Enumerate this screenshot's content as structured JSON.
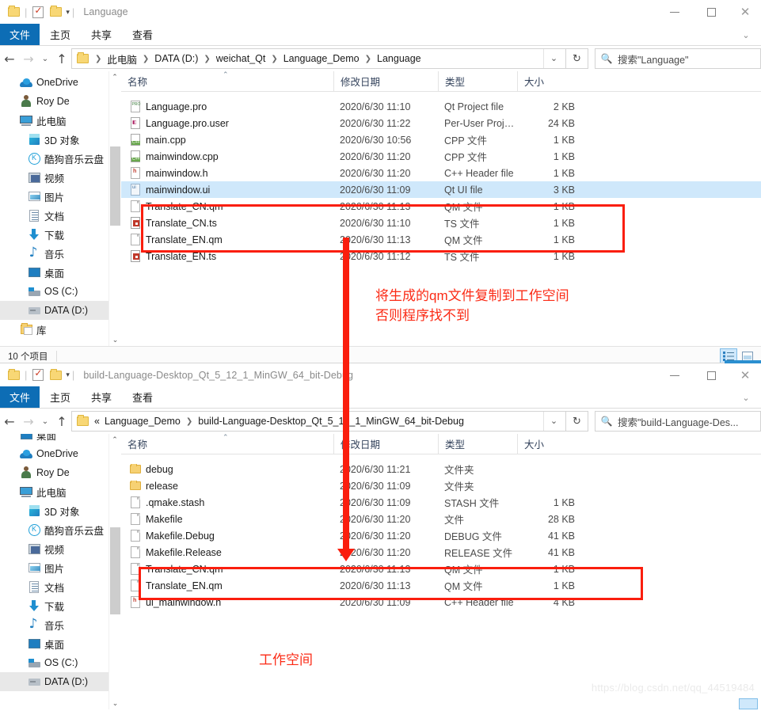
{
  "windows": [
    {
      "id": "window-language",
      "title": "Language",
      "quick_access": {
        "folder_icon": "folder-icon",
        "checkbox_icon": "checkbox-icon",
        "folder_icon_2": "folder-icon",
        "caret_icon": "chevron-down-icon"
      },
      "window_controls": {
        "minimize": "minimize-icon",
        "maximize": "maximize-icon",
        "close": "close-icon"
      },
      "ribbon_tabs": [
        {
          "label": "文件",
          "active": true
        },
        {
          "label": "主页",
          "active": false
        },
        {
          "label": "共享",
          "active": false
        },
        {
          "label": "查看",
          "active": false
        }
      ],
      "nav": {
        "back": "arrow-left-icon",
        "forward": "arrow-right-icon",
        "recent": "chevron-down-icon",
        "up": "arrow-up-icon"
      },
      "breadcrumbs": [
        "此电脑",
        "DATA (D:)",
        "weichat_Qt",
        "Language_Demo",
        "Language"
      ],
      "address_caret": "chevron-down-icon",
      "refresh": "refresh-icon",
      "search": {
        "placeholder": "搜索\"Language\"",
        "icon": "search-icon"
      },
      "nav_pane": [
        {
          "label": "OneDrive",
          "icon": "onedrive-cloud-icon",
          "indent": 1,
          "selected": false
        },
        {
          "label": "Roy De",
          "icon": "user-icon",
          "indent": 1,
          "selected": false
        },
        {
          "label": "此电脑",
          "icon": "this-pc-icon",
          "indent": 1,
          "selected": false
        },
        {
          "label": "3D 对象",
          "icon": "3d-objects-icon",
          "indent": 2,
          "selected": false
        },
        {
          "label": "酷狗音乐云盘",
          "icon": "kugou-cloud-icon",
          "indent": 2,
          "selected": false
        },
        {
          "label": "视频",
          "icon": "videos-icon",
          "indent": 2,
          "selected": false
        },
        {
          "label": "图片",
          "icon": "pictures-icon",
          "indent": 2,
          "selected": false
        },
        {
          "label": "文档",
          "icon": "documents-icon",
          "indent": 2,
          "selected": false
        },
        {
          "label": "下载",
          "icon": "downloads-icon",
          "indent": 2,
          "selected": false
        },
        {
          "label": "音乐",
          "icon": "music-icon",
          "indent": 2,
          "selected": false
        },
        {
          "label": "桌面",
          "icon": "desktop-icon",
          "indent": 2,
          "selected": false
        },
        {
          "label": "OS (C:)",
          "icon": "os-drive-icon",
          "indent": 2,
          "selected": false
        },
        {
          "label": "DATA (D:)",
          "icon": "drive-icon",
          "indent": 2,
          "selected": true
        },
        {
          "label": "库",
          "icon": "libraries-icon",
          "indent": 1,
          "selected": false
        }
      ],
      "nav_scroll": {
        "up": "scroll-up-icon",
        "down": "scroll-down-icon"
      },
      "columns": [
        "名称",
        "修改日期",
        "类型",
        "大小"
      ],
      "sort_column": "名称",
      "sort_direction": "ascending",
      "files": [
        {
          "name": "Language.pro",
          "date": "2020/6/30 11:10",
          "type": "Qt Project file",
          "size": "2 KB",
          "icon": "pro-file-icon",
          "selected": false
        },
        {
          "name": "Language.pro.user",
          "date": "2020/6/30 11:22",
          "type": "Per-User Project...",
          "size": "24 KB",
          "icon": "user-file-icon",
          "selected": false
        },
        {
          "name": "main.cpp",
          "date": "2020/6/30 10:56",
          "type": "CPP 文件",
          "size": "1 KB",
          "icon": "cpp-file-icon",
          "selected": false
        },
        {
          "name": "mainwindow.cpp",
          "date": "2020/6/30 11:20",
          "type": "CPP 文件",
          "size": "1 KB",
          "icon": "cpp-file-icon",
          "selected": false
        },
        {
          "name": "mainwindow.h",
          "date": "2020/6/30 11:20",
          "type": "C++ Header file",
          "size": "1 KB",
          "icon": "h-file-icon",
          "selected": false
        },
        {
          "name": "mainwindow.ui",
          "date": "2020/6/30 11:09",
          "type": "Qt UI file",
          "size": "3 KB",
          "icon": "ui-file-icon",
          "selected": true
        },
        {
          "name": "Translate_CN.qm",
          "date": "2020/6/30 11:13",
          "type": "QM 文件",
          "size": "1 KB",
          "icon": "qm-file-icon",
          "selected": false
        },
        {
          "name": "Translate_CN.ts",
          "date": "2020/6/30 11:10",
          "type": "TS 文件",
          "size": "1 KB",
          "icon": "ts-file-icon",
          "selected": false
        },
        {
          "name": "Translate_EN.qm",
          "date": "2020/6/30 11:13",
          "type": "QM 文件",
          "size": "1 KB",
          "icon": "qm-file-icon",
          "selected": false
        },
        {
          "name": "Translate_EN.ts",
          "date": "2020/6/30 11:12",
          "type": "TS 文件",
          "size": "1 KB",
          "icon": "ts-file-icon",
          "selected": false
        }
      ],
      "status": {
        "item_count": "10 个项目"
      },
      "view_buttons": [
        "details-view-icon",
        "large-icons-view-icon"
      ]
    },
    {
      "id": "window-build-dir",
      "title": "build-Language-Desktop_Qt_5_12_1_MinGW_64_bit-Debug",
      "quick_access": {
        "folder_icon": "folder-icon",
        "checkbox_icon": "checkbox-icon",
        "folder_icon_2": "folder-icon",
        "caret_icon": "chevron-down-icon"
      },
      "window_controls": {
        "minimize": "minimize-icon",
        "maximize": "maximize-icon",
        "close": "close-icon"
      },
      "ribbon_tabs": [
        {
          "label": "文件",
          "active": true
        },
        {
          "label": "主页",
          "active": false
        },
        {
          "label": "共享",
          "active": false
        },
        {
          "label": "查看",
          "active": false
        }
      ],
      "nav": {
        "back": "arrow-left-icon",
        "forward": "arrow-right-icon",
        "recent": "chevron-down-icon",
        "up": "arrow-up-icon"
      },
      "breadcrumb_overflow": "«",
      "breadcrumbs": [
        "Language_Demo",
        "build-Language-Desktop_Qt_5_12_1_MinGW_64_bit-Debug"
      ],
      "address_caret": "chevron-down-icon",
      "refresh": "refresh-icon",
      "search": {
        "placeholder": "搜索\"build-Language-Des...",
        "icon": "search-icon"
      },
      "nav_pane": [
        {
          "label": "桌面",
          "icon": "desktop-icon",
          "indent": 1,
          "selected": false
        },
        {
          "label": "OneDrive",
          "icon": "onedrive-cloud-icon",
          "indent": 1,
          "selected": false
        },
        {
          "label": "Roy De",
          "icon": "user-icon",
          "indent": 1,
          "selected": false
        },
        {
          "label": "此电脑",
          "icon": "this-pc-icon",
          "indent": 1,
          "selected": false
        },
        {
          "label": "3D 对象",
          "icon": "3d-objects-icon",
          "indent": 2,
          "selected": false
        },
        {
          "label": "酷狗音乐云盘",
          "icon": "kugou-cloud-icon",
          "indent": 2,
          "selected": false
        },
        {
          "label": "视频",
          "icon": "videos-icon",
          "indent": 2,
          "selected": false
        },
        {
          "label": "图片",
          "icon": "pictures-icon",
          "indent": 2,
          "selected": false
        },
        {
          "label": "文档",
          "icon": "documents-icon",
          "indent": 2,
          "selected": false
        },
        {
          "label": "下载",
          "icon": "downloads-icon",
          "indent": 2,
          "selected": false
        },
        {
          "label": "音乐",
          "icon": "music-icon",
          "indent": 2,
          "selected": false
        },
        {
          "label": "桌面",
          "icon": "desktop-icon",
          "indent": 2,
          "selected": false
        },
        {
          "label": "OS (C:)",
          "icon": "os-drive-icon",
          "indent": 2,
          "selected": false
        },
        {
          "label": "DATA (D:)",
          "icon": "drive-icon",
          "indent": 2,
          "selected": true
        }
      ],
      "nav_scroll": {
        "up": "scroll-up-icon",
        "down": "scroll-down-icon"
      },
      "columns": [
        "名称",
        "修改日期",
        "类型",
        "大小"
      ],
      "sort_column": "名称",
      "sort_direction": "ascending",
      "files": [
        {
          "name": "debug",
          "date": "2020/6/30 11:21",
          "type": "文件夹",
          "size": "",
          "icon": "folder-icon",
          "selected": false
        },
        {
          "name": "release",
          "date": "2020/6/30 11:09",
          "type": "文件夹",
          "size": "",
          "icon": "folder-icon",
          "selected": false
        },
        {
          "name": ".qmake.stash",
          "date": "2020/6/30 11:09",
          "type": "STASH 文件",
          "size": "1 KB",
          "icon": "blank-file-icon",
          "selected": false
        },
        {
          "name": "Makefile",
          "date": "2020/6/30 11:20",
          "type": "文件",
          "size": "28 KB",
          "icon": "blank-file-icon",
          "selected": false
        },
        {
          "name": "Makefile.Debug",
          "date": "2020/6/30 11:20",
          "type": "DEBUG 文件",
          "size": "41 KB",
          "icon": "blank-file-icon",
          "selected": false
        },
        {
          "name": "Makefile.Release",
          "date": "2020/6/30 11:20",
          "type": "RELEASE 文件",
          "size": "41 KB",
          "icon": "blank-file-icon",
          "selected": false
        },
        {
          "name": "Translate_CN.qm",
          "date": "2020/6/30 11:13",
          "type": "QM 文件",
          "size": "1 KB",
          "icon": "qm-file-icon",
          "selected": false
        },
        {
          "name": "Translate_EN.qm",
          "date": "2020/6/30 11:13",
          "type": "QM 文件",
          "size": "1 KB",
          "icon": "qm-file-icon",
          "selected": false
        },
        {
          "name": "ui_mainwindow.h",
          "date": "2020/6/30 11:09",
          "type": "C++ Header file",
          "size": "4 KB",
          "icon": "h-file-icon",
          "selected": false
        }
      ]
    }
  ],
  "annotations": {
    "accent_color": "#fa1e0e",
    "note_main": "将生成的qm文件复制到工作空间\n否则程序找不到",
    "note_bottom": "工作空间",
    "arrow": "down-arrow-annotation",
    "highlight_rect_1": "highlight-source-qm-files",
    "highlight_rect_2": "highlight-target-qm-files"
  },
  "watermark": "https://blog.csdn.net/qq_44519484"
}
